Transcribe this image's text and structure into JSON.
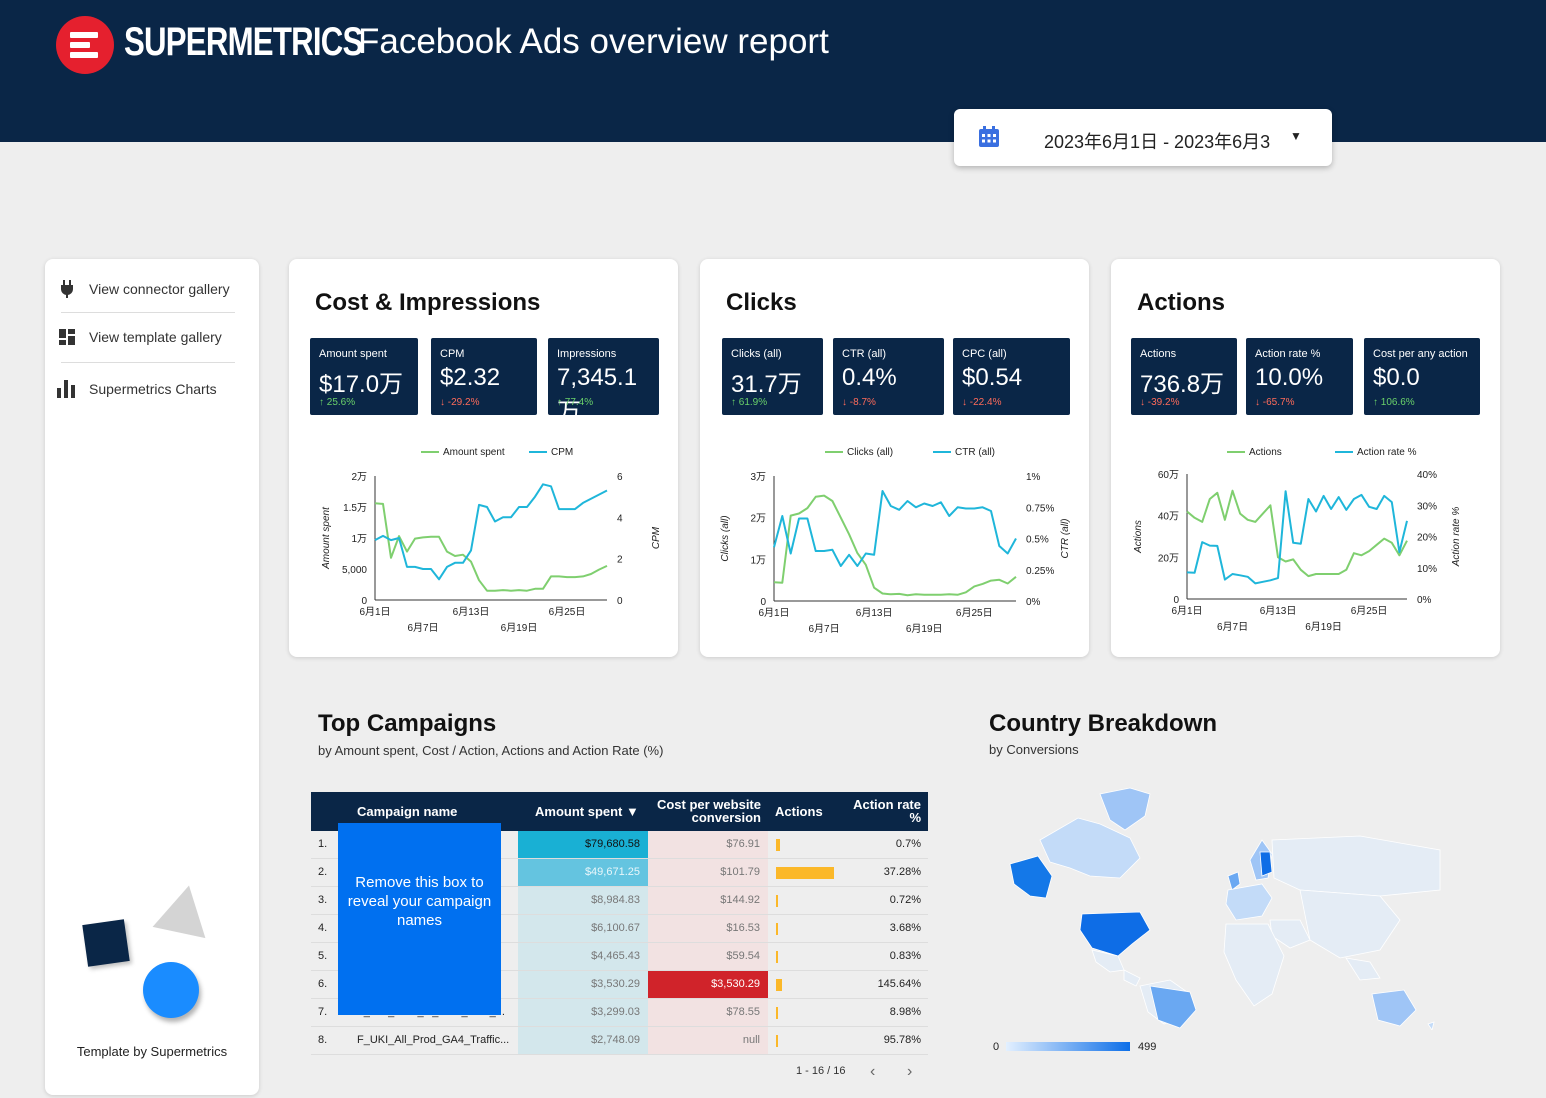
{
  "header": {
    "brand": "SUPERMETRICS",
    "title": "Facebook Ads overview report",
    "date_range": "2023年6月1日 - 2023年6月3",
    "bg_color": "#0a2647",
    "logo_color": "#e5202e"
  },
  "sidebar": {
    "items": [
      {
        "label": "View connector gallery",
        "icon": "plug-icon"
      },
      {
        "label": "View template gallery",
        "icon": "grid-icon"
      },
      {
        "label": "Supermetrics Charts",
        "icon": "bar-chart-icon"
      }
    ],
    "credit": "Template by Supermetrics"
  },
  "cards": [
    {
      "title": "Cost & Impressions",
      "kpis": [
        {
          "label": "Amount spent",
          "value": "$17.0万",
          "delta": "↑ 25.6%",
          "dir": "up"
        },
        {
          "label": "CPM",
          "value": "$2.32",
          "delta": "↓ -29.2%",
          "dir": "down"
        },
        {
          "label": "Impressions",
          "value": "7,345.1万",
          "delta": "↑ 77.4%",
          "dir": "up"
        }
      ]
    },
    {
      "title": "Clicks",
      "kpis": [
        {
          "label": "Clicks (all)",
          "value": "31.7万",
          "delta": "↑ 61.9%",
          "dir": "up"
        },
        {
          "label": "CTR (all)",
          "value": "0.4%",
          "delta": "↓ -8.7%",
          "dir": "down"
        },
        {
          "label": "CPC (all)",
          "value": "$0.54",
          "delta": "↓ -22.4%",
          "dir": "down"
        }
      ]
    },
    {
      "title": "Actions",
      "kpis": [
        {
          "label": "Actions",
          "value": "736.8万",
          "delta": "↓ -39.2%",
          "dir": "down"
        },
        {
          "label": "Action rate %",
          "value": "10.0%",
          "delta": "↓ -65.7%",
          "dir": "down"
        },
        {
          "label": "Cost per any action",
          "value": "$0.0",
          "delta": "↑ 106.6%",
          "dir": "up"
        }
      ]
    }
  ],
  "chart_data": [
    {
      "type": "line",
      "x": [
        "6月1日",
        "6月2日",
        "6月3日",
        "6月4日",
        "6月5日",
        "6月6日",
        "6月7日",
        "6月8日",
        "6月9日",
        "6月10日",
        "6月11日",
        "6月12日",
        "6月13日",
        "6月14日",
        "6月15日",
        "6月16日",
        "6月17日",
        "6月18日",
        "6月19日",
        "6月20日",
        "6月21日",
        "6月22日",
        "6月23日",
        "6月24日",
        "6月25日",
        "6月26日",
        "6月27日",
        "6月28日",
        "6月29日",
        "6月30日"
      ],
      "x_ticks_top": [
        "6月1日",
        "6月13日",
        "6月25日"
      ],
      "x_ticks_bottom": [
        "6月7日",
        "6月19日"
      ],
      "left_ticks": [
        "0",
        "5,000",
        "1万",
        "1.5万",
        "2万"
      ],
      "right_ticks": [
        "0",
        "2",
        "4",
        "6"
      ],
      "ylabel": "Amount spent",
      "y2label": "CPM",
      "ylim": [
        0,
        20000
      ],
      "y2lim": [
        0,
        6
      ],
      "series": [
        {
          "name": "Amount spent",
          "axis": "left",
          "color": "#7fcf6f",
          "values": [
            15600,
            15500,
            6800,
            10300,
            7800,
            9900,
            10100,
            10200,
            10200,
            7800,
            7100,
            7300,
            6200,
            3200,
            1500,
            1500,
            1600,
            1500,
            1600,
            1500,
            1800,
            1800,
            3800,
            3800,
            3700,
            3700,
            3800,
            4200,
            4900,
            5500
          ]
        },
        {
          "name": "CPM",
          "axis": "right",
          "color": "#1fb6da",
          "values": [
            2.9,
            3.1,
            2.9,
            3.0,
            1.6,
            1.6,
            1.5,
            1.5,
            1.0,
            1.6,
            1.8,
            1.8,
            2.4,
            4.6,
            4.5,
            3.8,
            4.0,
            4.0,
            4.5,
            4.5,
            5.0,
            5.6,
            5.5,
            4.4,
            4.4,
            4.4,
            4.7,
            4.9,
            5.1,
            5.3
          ]
        }
      ]
    },
    {
      "type": "line",
      "x": [
        "6月1日",
        "6月2日",
        "6月3日",
        "6月4日",
        "6月5日",
        "6月6日",
        "6月7日",
        "6月8日",
        "6月9日",
        "6月10日",
        "6月11日",
        "6月12日",
        "6月13日",
        "6月14日",
        "6月15日",
        "6月16日",
        "6月17日",
        "6月18日",
        "6月19日",
        "6月20日",
        "6月21日",
        "6月22日",
        "6月23日",
        "6月24日",
        "6月25日",
        "6月26日",
        "6月27日",
        "6月28日",
        "6月29日",
        "6月30日"
      ],
      "x_ticks_top": [
        "6月1日",
        "6月13日",
        "6月25日"
      ],
      "x_ticks_bottom": [
        "6月7日",
        "6月19日"
      ],
      "left_ticks": [
        "0",
        "1万",
        "2万",
        "3万"
      ],
      "right_ticks": [
        "0%",
        "0.25%",
        "0.5%",
        "0.75%",
        "1%"
      ],
      "ylabel": "Clicks (all)",
      "y2label": "CTR (all)",
      "ylim": [
        0,
        30000
      ],
      "y2lim": [
        0,
        1
      ],
      "series": [
        {
          "name": "Clicks (all)",
          "axis": "left",
          "color": "#7fcf6f",
          "values": [
            4500,
            4400,
            20500,
            21000,
            22300,
            25000,
            25300,
            24000,
            20000,
            16000,
            11500,
            8700,
            3200,
            1800,
            1600,
            1700,
            1400,
            1600,
            1500,
            1500,
            1500,
            1600,
            1500,
            2100,
            3500,
            4100,
            4900,
            5100,
            4200,
            5800
          ]
        },
        {
          "name": "CTR (all)",
          "axis": "right",
          "color": "#1fb6da",
          "values": [
            0.43,
            0.68,
            0.38,
            0.66,
            0.66,
            0.4,
            0.4,
            0.41,
            0.28,
            0.37,
            0.28,
            0.38,
            0.37,
            0.88,
            0.76,
            0.73,
            0.8,
            0.75,
            0.78,
            0.76,
            0.79,
            0.68,
            0.75,
            0.74,
            0.74,
            0.75,
            0.72,
            0.44,
            0.38,
            0.5
          ]
        }
      ]
    },
    {
      "type": "line",
      "x": [
        "6月1日",
        "6月2日",
        "6月3日",
        "6月4日",
        "6月5日",
        "6月6日",
        "6月7日",
        "6月8日",
        "6月9日",
        "6月10日",
        "6月11日",
        "6月12日",
        "6月13日",
        "6月14日",
        "6月15日",
        "6月16日",
        "6月17日",
        "6月18日",
        "6月19日",
        "6月20日",
        "6月21日",
        "6月22日",
        "6月23日",
        "6月24日",
        "6月25日",
        "6月26日",
        "6月27日",
        "6月28日",
        "6月29日",
        "6月30日"
      ],
      "x_ticks_top": [
        "6月1日",
        "6月13日",
        "6月25日"
      ],
      "x_ticks_bottom": [
        "6月7日",
        "6月19日"
      ],
      "left_ticks": [
        "0",
        "20万",
        "40万",
        "60万"
      ],
      "right_ticks": [
        "0%",
        "10%",
        "20%",
        "30%",
        "40%"
      ],
      "ylabel": "Actions",
      "y2label": "Action rate %",
      "ylim": [
        0,
        600000
      ],
      "y2lim": [
        0,
        40
      ],
      "series": [
        {
          "name": "Actions",
          "axis": "left",
          "color": "#7fcf6f",
          "values": [
            420000,
            390000,
            370000,
            480000,
            510000,
            380000,
            520000,
            410000,
            380000,
            370000,
            410000,
            450000,
            200000,
            180000,
            190000,
            140000,
            110000,
            120000,
            120000,
            120000,
            120000,
            140000,
            220000,
            210000,
            230000,
            260000,
            290000,
            270000,
            210000,
            280000
          ]
        },
        {
          "name": "Action rate %",
          "axis": "right",
          "color": "#1fb6da",
          "values": [
            8.5,
            8.4,
            18.2,
            17.1,
            17.0,
            6.2,
            8.0,
            7.6,
            7.1,
            5.0,
            5.5,
            6.0,
            6.7,
            34.5,
            18.0,
            17.7,
            32.0,
            28.0,
            33.0,
            28.8,
            32.6,
            28.5,
            32.0,
            33.3,
            29.5,
            28.8,
            33.0,
            31.0,
            15.0,
            25.0
          ]
        }
      ]
    },
    {
      "type": "table",
      "title": "Top Campaigns",
      "subtitle": "by  Amount spent, Cost / Action, Actions and Action Rate (%)",
      "columns": [
        "Campaign name",
        "Amount spent ▼",
        "Cost per website conversion",
        "Actions",
        "Action rate %"
      ],
      "rows": [
        {
          "num": "1.",
          "name": "...",
          "amount": "$79,680.58",
          "cost": "$76.91",
          "actions": 0.04,
          "rate": "0.7%"
        },
        {
          "num": "2.",
          "name": "...",
          "amount": "$49,671.25",
          "cost": "$101.79",
          "actions": 0.55,
          "rate": "37.28%"
        },
        {
          "num": "3.",
          "name": "...",
          "amount": "$8,984.83",
          "cost": "$144.92",
          "actions": 0.01,
          "rate": "0.72%"
        },
        {
          "num": "4.",
          "name": "...",
          "amount": "$6,100.67",
          "cost": "$16.53",
          "actions": 0.01,
          "rate": "3.68%"
        },
        {
          "num": "5.",
          "name": "...",
          "amount": "$4,465.43",
          "cost": "$59.54",
          "actions": 0.01,
          "rate": "0.83%"
        },
        {
          "num": "6.",
          "name": "...",
          "amount": "$3,530.29",
          "cost": "$3,530.29",
          "actions": 0.06,
          "rate": "145.64%"
        },
        {
          "num": "7.",
          "name": "F_UKI_DCP_G_Prod_GA4_...",
          "amount": "$3,299.03",
          "cost": "$78.55",
          "actions": 0.01,
          "rate": "8.98%"
        },
        {
          "num": "8.",
          "name": "F_UKI_All_Prod_GA4_Traffic...",
          "amount": "$2,748.09",
          "cost": "null",
          "actions": 0.01,
          "rate": "95.78%"
        }
      ]
    }
  ],
  "table_overlay": "Remove this box to reveal your campaign names",
  "pager": {
    "label": "1 - 16 / 16",
    "prev": "‹",
    "next": "›"
  },
  "country": {
    "title": "Country Breakdown",
    "subtitle": "by Conversions",
    "legend_min": "0",
    "legend_max": "499"
  },
  "colors": {
    "navy": "#0a2647",
    "green_series": "#7fcf6f",
    "blue_series": "#1fb6da",
    "overlay": "#0070f0",
    "bar_yellow": "#fbb829"
  }
}
